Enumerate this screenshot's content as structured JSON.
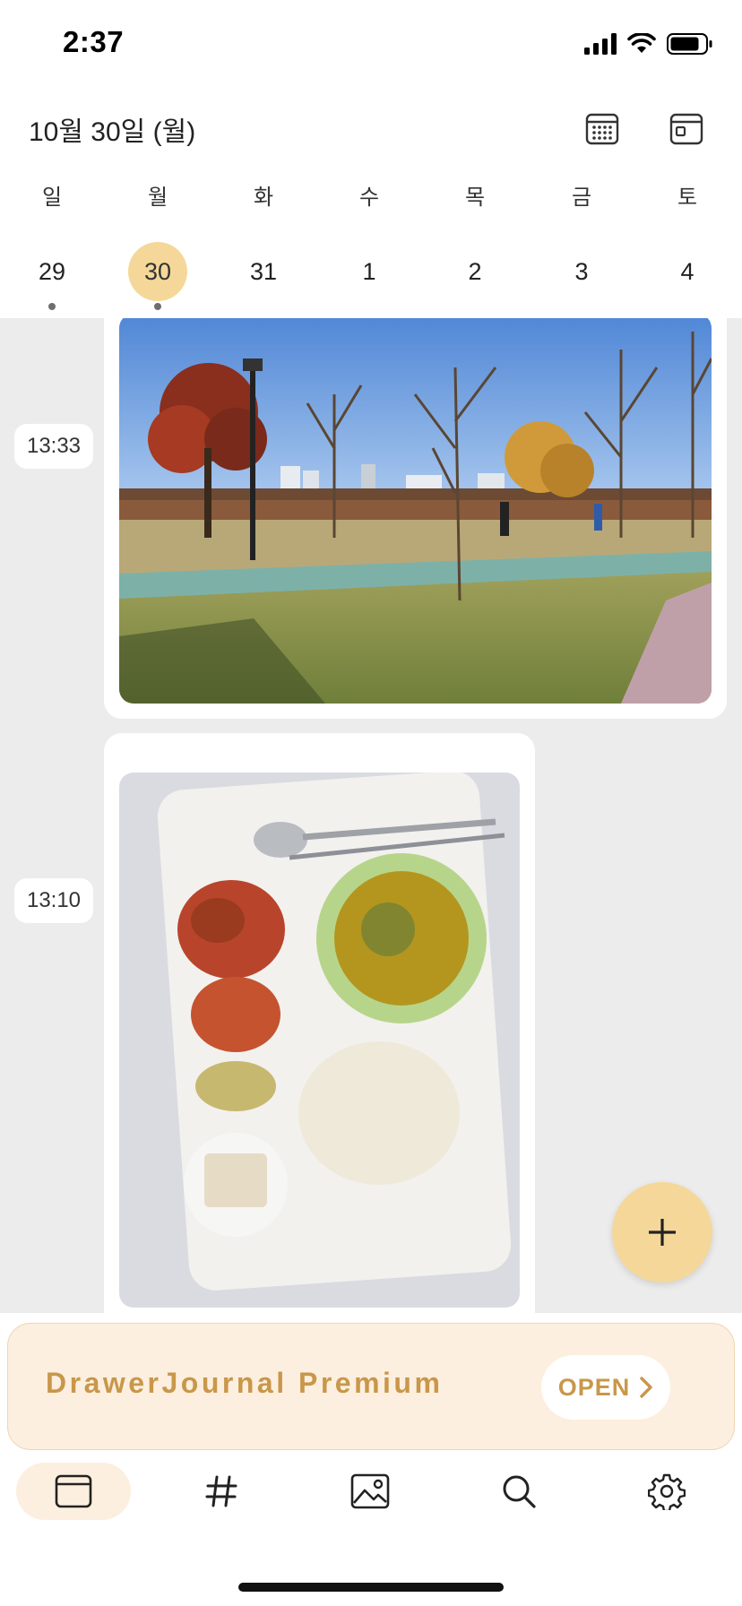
{
  "status_bar": {
    "time": "2:37",
    "icons": [
      "signal-icon",
      "wifi-icon",
      "battery-icon"
    ]
  },
  "header": {
    "date": "10월 30일 (월)",
    "icons": [
      "calendar-month-icon",
      "calendar-day-icon"
    ]
  },
  "week": {
    "weekdays": [
      "일",
      "월",
      "화",
      "수",
      "목",
      "금",
      "토"
    ],
    "days": [
      {
        "num": "29",
        "selected": false,
        "has_entries": true
      },
      {
        "num": "30",
        "selected": true,
        "has_entries": true
      },
      {
        "num": "31",
        "selected": false,
        "has_entries": false
      },
      {
        "num": "1",
        "selected": false,
        "has_entries": false
      },
      {
        "num": "2",
        "selected": false,
        "has_entries": false
      },
      {
        "num": "3",
        "selected": false,
        "has_entries": false
      },
      {
        "num": "4",
        "selected": false,
        "has_entries": false
      }
    ]
  },
  "entries": [
    {
      "time": "13:33",
      "photo": "park-photo"
    },
    {
      "time": "13:10",
      "photo": "meal-tray-photo"
    }
  ],
  "fab": {
    "icon": "plus-icon"
  },
  "premium": {
    "title": "DrawerJournal Premium",
    "open_label": "OPEN",
    "icon": "chevron-right-icon"
  },
  "tabs": [
    {
      "icon": "journal-icon",
      "active": true
    },
    {
      "icon": "hashtag-icon",
      "active": false
    },
    {
      "icon": "image-icon",
      "active": false
    },
    {
      "icon": "search-icon",
      "active": false
    },
    {
      "icon": "gear-icon",
      "active": false
    }
  ],
  "colors": {
    "accent": "#f5d899",
    "premium_bg": "#fcefdf",
    "premium_text": "#c9974a",
    "timeline_bg": "#ececec"
  }
}
